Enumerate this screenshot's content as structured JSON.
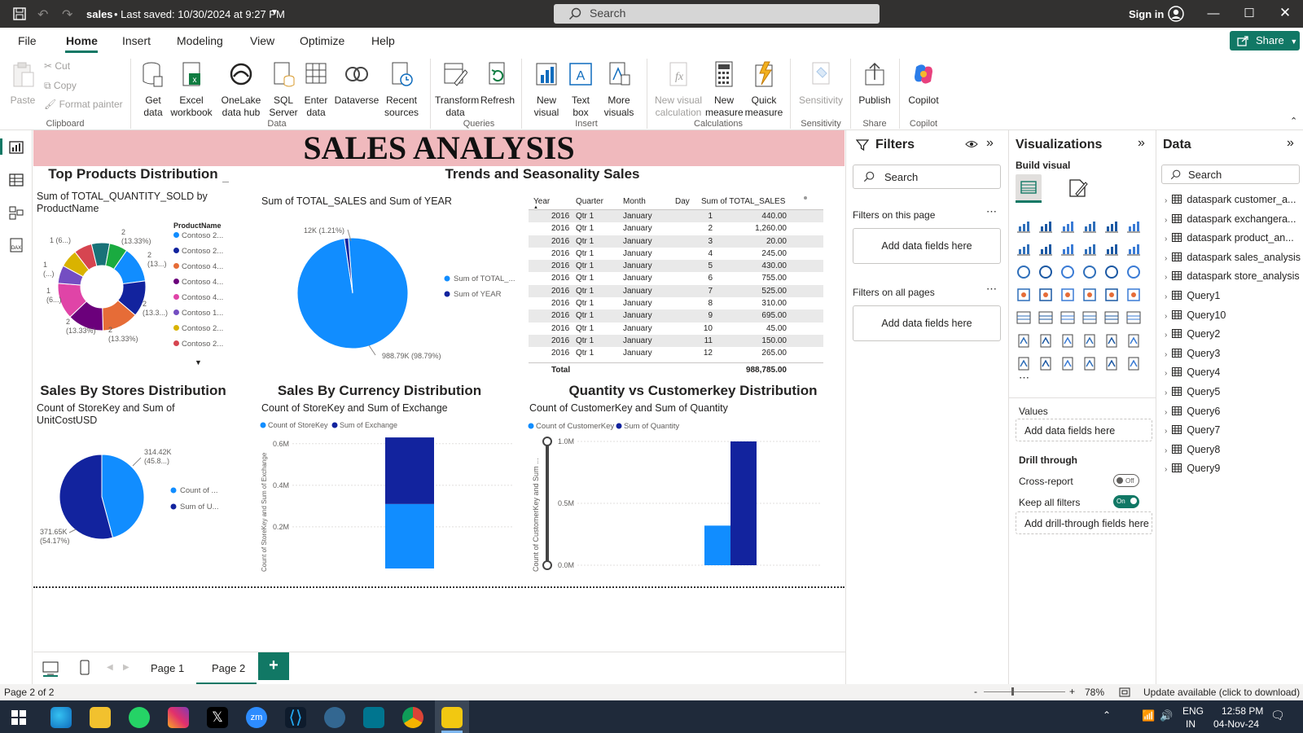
{
  "titlebar": {
    "file_name": "sales",
    "saved": "• Last saved: 10/30/2024 at 9:27 PM",
    "search_placeholder": "Search",
    "sign_in": "Sign in"
  },
  "menu": [
    "File",
    "Home",
    "Insert",
    "Modeling",
    "View",
    "Optimize",
    "Help"
  ],
  "share_label": "Share",
  "ribbon": {
    "clipboard": {
      "paste": "Paste",
      "cut": "Cut",
      "copy": "Copy",
      "format_painter": "Format painter",
      "group": "Clipboard"
    },
    "data": {
      "get_data": "Get data",
      "excel": "Excel workbook",
      "onelake": "OneLake data hub",
      "sql": "SQL Server",
      "enter": "Enter data",
      "dataverse": "Dataverse",
      "recent": "Recent sources",
      "group": "Data"
    },
    "queries": {
      "transform": "Transform data",
      "refresh": "Refresh",
      "group": "Queries"
    },
    "insert": {
      "new_visual": "New visual",
      "text_box": "Text box",
      "more_visuals": "More visuals",
      "group": "Insert"
    },
    "calculations": {
      "new_calc": "New visual calculation",
      "new_measure": "New measure",
      "quick_measure": "Quick measure",
      "group": "Calculations"
    },
    "sensitivity": {
      "label": "Sensitivity",
      "group": "Sensitivity"
    },
    "share": {
      "publish": "Publish",
      "group": "Share"
    },
    "copilot": {
      "label": "Copilot",
      "group": "Copilot"
    }
  },
  "report": {
    "banner": "SALES ANALYSIS",
    "donut": {
      "title": "Top Products Distribution",
      "subtitle": "Sum of TOTAL_QUANTITY_SOLD by ProductName",
      "legend_title": "ProductName",
      "legend": [
        "Contoso 2...",
        "Contoso 2...",
        "Contoso 4...",
        "Contoso 4...",
        "Contoso 4...",
        "Contoso 1...",
        "Contoso 2...",
        "Contoso 2..."
      ],
      "labels": [
        "2\n(13.33%)",
        "2\n(13...)",
        "2\n(13.3...)",
        "2\n(13.33%)",
        "2\n(13.33%)",
        "1\n(6...)",
        "1\n(...)",
        "1 (6...)"
      ]
    },
    "trends": {
      "title": "Trends and Seasonality Sales",
      "pie_subtitle": "Sum of TOTAL_SALES and Sum of YEAR",
      "pie_label_small": "12K (1.21%)",
      "pie_label_big": "988.79K (98.79%)",
      "legend": [
        "Sum of TOTAL_...",
        "Sum of YEAR"
      ]
    },
    "table": {
      "headers": [
        "Year",
        "Quarter",
        "Month",
        "Day",
        "Sum of TOTAL_SALES"
      ],
      "rows": [
        [
          "2016",
          "Qtr 1",
          "January",
          "1",
          "440.00"
        ],
        [
          "2016",
          "Qtr 1",
          "January",
          "2",
          "1,260.00"
        ],
        [
          "2016",
          "Qtr 1",
          "January",
          "3",
          "20.00"
        ],
        [
          "2016",
          "Qtr 1",
          "January",
          "4",
          "245.00"
        ],
        [
          "2016",
          "Qtr 1",
          "January",
          "5",
          "430.00"
        ],
        [
          "2016",
          "Qtr 1",
          "January",
          "6",
          "755.00"
        ],
        [
          "2016",
          "Qtr 1",
          "January",
          "7",
          "525.00"
        ],
        [
          "2016",
          "Qtr 1",
          "January",
          "8",
          "310.00"
        ],
        [
          "2016",
          "Qtr 1",
          "January",
          "9",
          "695.00"
        ],
        [
          "2016",
          "Qtr 1",
          "January",
          "10",
          "45.00"
        ],
        [
          "2016",
          "Qtr 1",
          "January",
          "11",
          "150.00"
        ],
        [
          "2016",
          "Qtr 1",
          "January",
          "12",
          "265.00"
        ]
      ],
      "total_label": "Total",
      "total_value": "988,785.00"
    },
    "stores": {
      "title": "Sales By Stores Distribution",
      "subtitle": "Count of StoreKey and Sum of UnitCostUSD",
      "label_a": "314.42K\n(45.8...)",
      "label_b": "371.65K\n(54.17%)",
      "legend": [
        "Count of ...",
        "Sum of U..."
      ]
    },
    "currency": {
      "title": "Sales By Currency Distribution",
      "subtitle": "Count of StoreKey and Sum of Exchange",
      "legend": [
        "Count of StoreKey",
        "Sum of Exchange"
      ],
      "yaxis_label": "Count of StoreKey and Sum of Exchange",
      "ticks": [
        "0.6M",
        "0.4M",
        "0.2M"
      ]
    },
    "quantity": {
      "title": "Quantity vs Customerkey Distribution",
      "subtitle": "Count of CustomerKey and Sum of Quantity",
      "legend": [
        "Count of CustomerKey",
        "Sum of Quantity"
      ],
      "yaxis_label": "Count of CustomerKey and Sum ...",
      "ticks": [
        "1.0M",
        "0.5M",
        "0.0M"
      ]
    }
  },
  "chart_data": [
    {
      "type": "pie",
      "title": "Top Products Distribution",
      "subtitle": "Sum of TOTAL_QUANTITY_SOLD by ProductName",
      "categories": [
        "Contoso 2...",
        "Contoso 2...",
        "Contoso 4...",
        "Contoso 4...",
        "Contoso 4...",
        "Contoso 1...",
        "Contoso 2...",
        "Contoso 2..."
      ],
      "values": [
        2,
        2,
        2,
        2,
        2,
        1,
        1,
        1,
        1,
        1
      ],
      "colors": [
        "#118dff",
        "#12239e",
        "#e66c37",
        "#6b007b",
        "#e044a7",
        "#744ec2",
        "#d9b300",
        "#d64550",
        "#197278",
        "#1aab40"
      ]
    },
    {
      "type": "pie",
      "title": "Trends and Seasonality Sales",
      "subtitle": "Sum of TOTAL_SALES and Sum of YEAR",
      "categories": [
        "Sum of TOTAL_...",
        "Sum of YEAR"
      ],
      "values": [
        988790,
        12000
      ]
    },
    {
      "type": "pie",
      "title": "Sales By Stores Distribution",
      "subtitle": "Count of StoreKey and Sum of UnitCostUSD",
      "categories": [
        "Count of ...",
        "Sum of U..."
      ],
      "values": [
        314420,
        371650
      ]
    },
    {
      "type": "bar",
      "title": "Sales By Currency Distribution",
      "stacked": true,
      "series": [
        {
          "name": "Count of StoreKey",
          "values": [
            0.31
          ]
        },
        {
          "name": "Sum of Exchange",
          "values": [
            0.32
          ]
        }
      ],
      "ylim": [
        0,
        0.65
      ]
    },
    {
      "type": "bar",
      "title": "Quantity vs Customerkey Distribution",
      "series": [
        {
          "name": "Count of CustomerKey",
          "values": [
            0.32
          ]
        },
        {
          "name": "Sum of Quantity",
          "values": [
            1.0
          ]
        }
      ],
      "ylim": [
        0,
        1.0
      ]
    }
  ],
  "pages": {
    "page1": "Page 1",
    "page2": "Page 2"
  },
  "filters": {
    "title": "Filters",
    "search": "Search",
    "on_page": "Filters on this page",
    "add1": "Add data fields here",
    "on_all": "Filters on all pages",
    "add2": "Add data fields here"
  },
  "viz": {
    "title": "Visualizations",
    "build": "Build visual",
    "values": "Values",
    "values_add": "Add data fields here",
    "drill": "Drill through",
    "cross": "Cross-report",
    "cross_state": "Off",
    "keep": "Keep all filters",
    "keep_state": "On",
    "drill_add": "Add drill-through fields here"
  },
  "datapane": {
    "title": "Data",
    "search": "Search",
    "items": [
      "dataspark customer_a...",
      "dataspark exchangera...",
      "dataspark product_an...",
      "dataspark sales_analysis",
      "dataspark store_analysis",
      "Query1",
      "Query10",
      "Query2",
      "Query3",
      "Query4",
      "Query5",
      "Query6",
      "Query7",
      "Query8",
      "Query9"
    ]
  },
  "status": {
    "page": "Page 2 of 2",
    "zoom": "78%",
    "update": "Update available (click to download)"
  },
  "taskbar": {
    "lang1": "ENG",
    "lang2": "IN",
    "time": "12:58 PM",
    "date": "04-Nov-24"
  }
}
